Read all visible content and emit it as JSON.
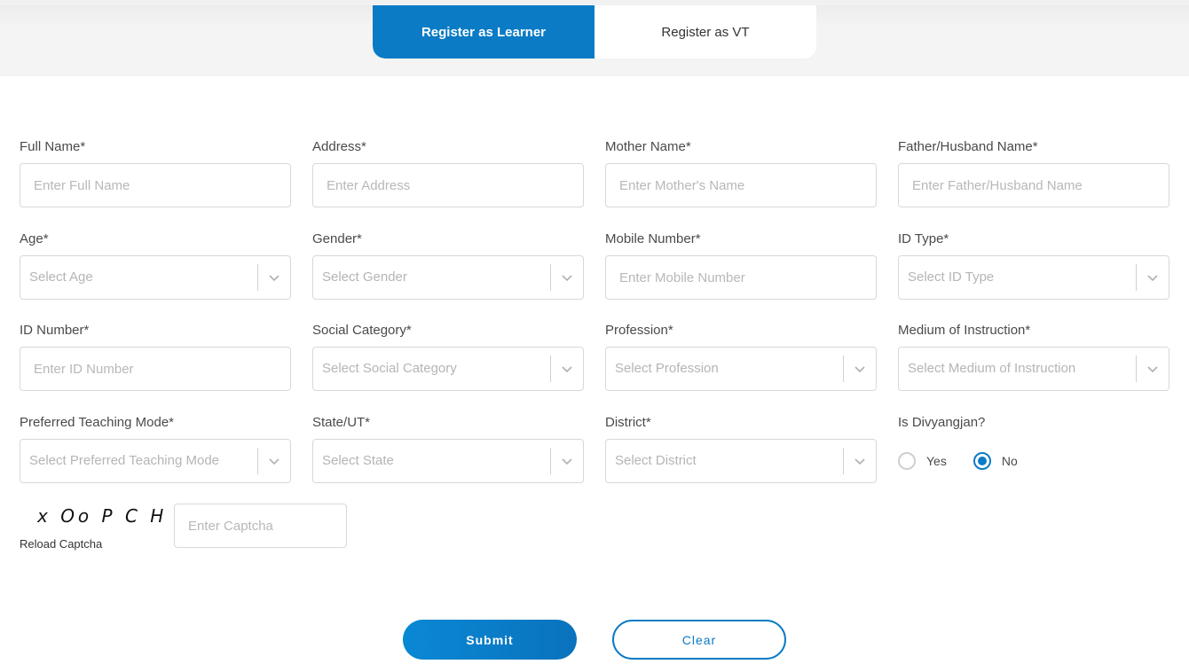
{
  "tabs": [
    {
      "label": "Register as Learner",
      "active": true
    },
    {
      "label": "Register as VT",
      "active": false
    }
  ],
  "fields": {
    "full_name": {
      "label": "Full Name*",
      "placeholder": "Enter Full Name"
    },
    "address": {
      "label": "Address*",
      "placeholder": "Enter Address"
    },
    "mother_name": {
      "label": "Mother Name*",
      "placeholder": "Enter Mother's Name"
    },
    "father_name": {
      "label": "Father/Husband Name*",
      "placeholder": "Enter Father/Husband Name"
    },
    "age": {
      "label": "Age*",
      "placeholder": "Select Age"
    },
    "gender": {
      "label": "Gender*",
      "placeholder": "Select Gender"
    },
    "mobile": {
      "label": "Mobile Number*",
      "placeholder": "Enter Mobile Number"
    },
    "id_type": {
      "label": "ID Type*",
      "placeholder": "Select ID Type"
    },
    "id_number": {
      "label": "ID Number*",
      "placeholder": "Enter ID Number"
    },
    "social_category": {
      "label": "Social Category*",
      "placeholder": "Select Social Category"
    },
    "profession": {
      "label": "Profession*",
      "placeholder": "Select Profession"
    },
    "medium": {
      "label": "Medium of Instruction*",
      "placeholder": "Select Medium of Instruction"
    },
    "teaching_mode": {
      "label": "Preferred Teaching Mode*",
      "placeholder": "Select Preferred Teaching Mode"
    },
    "state": {
      "label": "State/UT*",
      "placeholder": "Select State"
    },
    "district": {
      "label": "District*",
      "placeholder": "Select District"
    }
  },
  "divyangjan": {
    "label": "Is Divyangjan?",
    "options": [
      {
        "label": "Yes",
        "checked": false
      },
      {
        "label": "No",
        "checked": true
      }
    ]
  },
  "captcha": {
    "text": "x Oo P C H",
    "reload_label": "Reload Captcha",
    "placeholder": "Enter Captcha"
  },
  "buttons": {
    "submit": "Submit",
    "clear": "Clear"
  },
  "colors": {
    "accent": "#0a7bc4"
  }
}
